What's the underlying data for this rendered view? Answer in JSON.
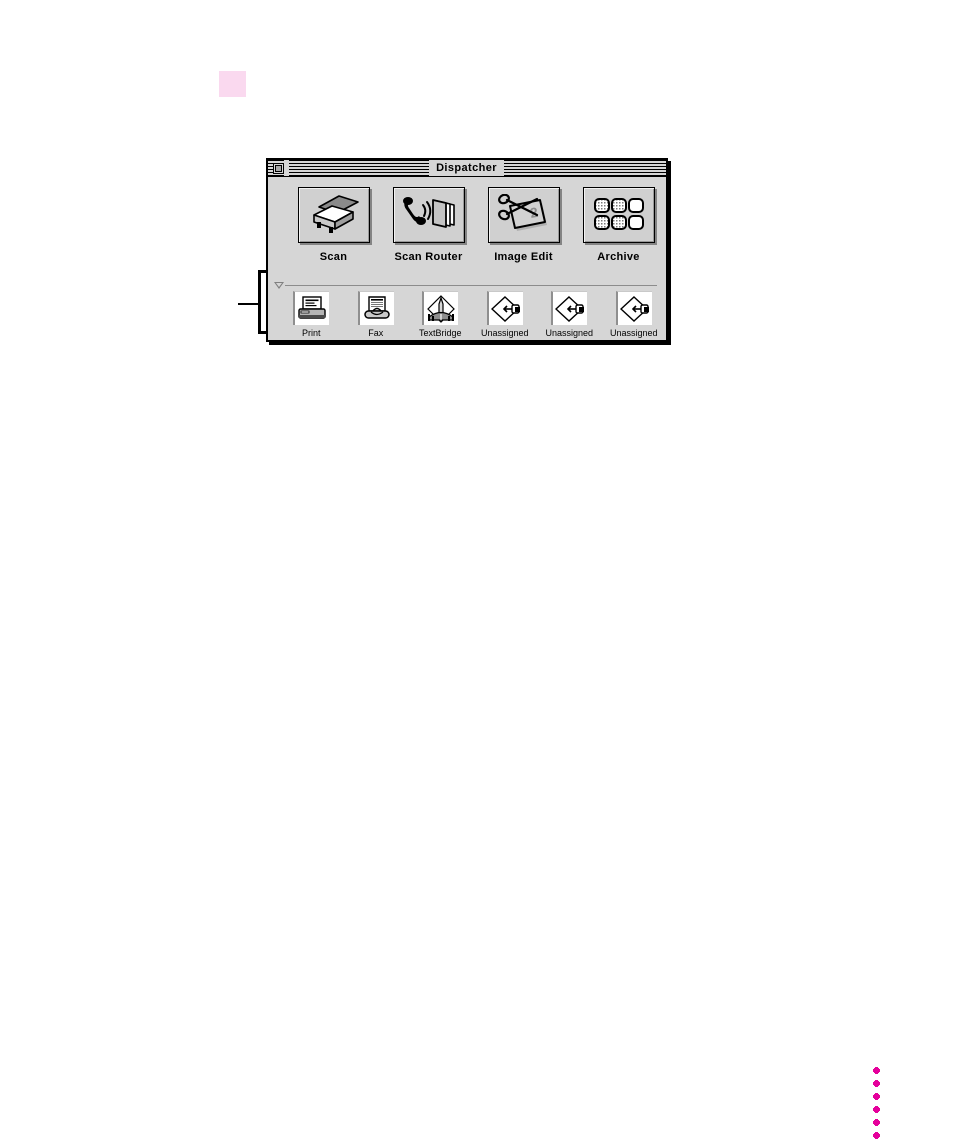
{
  "page": {
    "background_color": "#ffffff",
    "marker": {
      "name": "pink-highlight-square",
      "color": "#fad9ef"
    },
    "margin_dots": {
      "name": "magenta-dot-column",
      "color": "#e5009b",
      "count": 6
    },
    "callout": {
      "name": "left-bracket-callout",
      "color": "#000000"
    }
  },
  "window": {
    "title": "Dispatcher",
    "close_button_label": "",
    "background_color": "#d6d6d6",
    "border_color": "#000000"
  },
  "primary_buttons": [
    {
      "label": "Scan",
      "icon": "scanner-icon"
    },
    {
      "label": "Scan Router",
      "icon": "phone-pages-icon"
    },
    {
      "label": "Image Edit",
      "icon": "scissors-photo-icon"
    },
    {
      "label": "Archive",
      "icon": "grid-tiles-icon"
    }
  ],
  "disclosure": {
    "name": "disclosure-triangle",
    "state": "expanded"
  },
  "secondary_buttons": [
    {
      "label": "Print",
      "icon": "printer-icon"
    },
    {
      "label": "Fax",
      "icon": "fax-icon"
    },
    {
      "label": "TextBridge",
      "icon": "textbridge-icon"
    },
    {
      "label": "Unassigned",
      "icon": "unassigned-diamond-icon"
    },
    {
      "label": "Unassigned",
      "icon": "unassigned-diamond-icon"
    },
    {
      "label": "Unassigned",
      "icon": "unassigned-diamond-icon"
    }
  ]
}
